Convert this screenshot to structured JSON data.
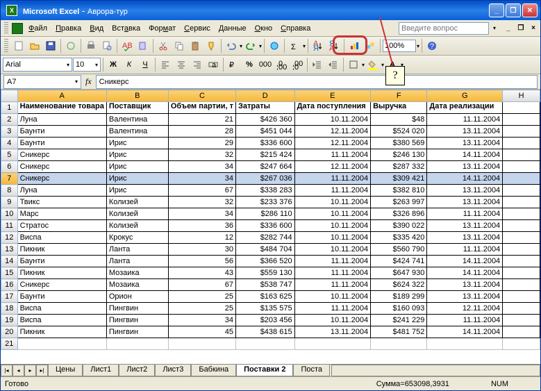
{
  "title_app": "Microsoft Excel",
  "title_doc": "Аврора-тур",
  "menus": {
    "file": "Файл",
    "edit": "Правка",
    "view": "Вид",
    "insert": "Вставка",
    "format": "Формат",
    "service": "Сервис",
    "data": "Данные",
    "window": "Окно",
    "help": "Справка"
  },
  "question_placeholder": "Введите вопрос",
  "zoom": "100%",
  "font_name": "Arial",
  "font_size": "10",
  "namebox": "A7",
  "formula": "Сникерс",
  "callout_text": "?",
  "columns": [
    "A",
    "B",
    "C",
    "D",
    "E",
    "F",
    "G",
    "H"
  ],
  "headers": {
    "col1": "Наименование товара",
    "col2": "Поставщик",
    "col3": "Объем партии, т",
    "col4": "Затраты",
    "col5": "Дата поступления",
    "col6": "Выручка",
    "col7": "Дата реализации"
  },
  "rows": [
    {
      "n": 2,
      "a": "Луна",
      "b": "Валентина",
      "c": "21",
      "d": "$426 360",
      "e": "10.11.2004",
      "f": "$48",
      "g": "11.11.2004"
    },
    {
      "n": 3,
      "a": "Баунти",
      "b": "Валентина",
      "c": "28",
      "d": "$451 044",
      "e": "12.11.2004",
      "f": "$524 020",
      "g": "13.11.2004"
    },
    {
      "n": 4,
      "a": "Баунти",
      "b": "Ирис",
      "c": "29",
      "d": "$336 600",
      "e": "12.11.2004",
      "f": "$380 569",
      "g": "13.11.2004"
    },
    {
      "n": 5,
      "a": "Сникерс",
      "b": "Ирис",
      "c": "32",
      "d": "$215 424",
      "e": "11.11.2004",
      "f": "$246 130",
      "g": "14.11.2004"
    },
    {
      "n": 6,
      "a": "Сникерс",
      "b": "Ирис",
      "c": "34",
      "d": "$247 664",
      "e": "12.11.2004",
      "f": "$287 332",
      "g": "13.11.2004"
    },
    {
      "n": 7,
      "a": "Сникерс",
      "b": "Ирис",
      "c": "34",
      "d": "$267 036",
      "e": "11.11.2004",
      "f": "$309 421",
      "g": "14.11.2004",
      "sel": true
    },
    {
      "n": 8,
      "a": "Луна",
      "b": "Ирис",
      "c": "67",
      "d": "$338 283",
      "e": "11.11.2004",
      "f": "$382 810",
      "g": "13.11.2004"
    },
    {
      "n": 9,
      "a": "Твикс",
      "b": "Колизей",
      "c": "32",
      "d": "$233 376",
      "e": "10.11.2004",
      "f": "$263 997",
      "g": "13.11.2004"
    },
    {
      "n": 10,
      "a": "Марс",
      "b": "Колизей",
      "c": "34",
      "d": "$286 110",
      "e": "10.11.2004",
      "f": "$326 896",
      "g": "11.11.2004"
    },
    {
      "n": 11,
      "a": "Стратос",
      "b": "Колизей",
      "c": "36",
      "d": "$336 600",
      "e": "10.11.2004",
      "f": "$390 022",
      "g": "13.11.2004"
    },
    {
      "n": 12,
      "a": "Виспа",
      "b": "Крокус",
      "c": "12",
      "d": "$282 744",
      "e": "10.11.2004",
      "f": "$335 420",
      "g": "13.11.2004"
    },
    {
      "n": 13,
      "a": "Пикник",
      "b": "Ланта",
      "c": "30",
      "d": "$484 704",
      "e": "10.11.2004",
      "f": "$560 790",
      "g": "11.11.2004"
    },
    {
      "n": 14,
      "a": "Баунти",
      "b": "Ланта",
      "c": "56",
      "d": "$366 520",
      "e": "11.11.2004",
      "f": "$424 741",
      "g": "14.11.2004"
    },
    {
      "n": 15,
      "a": "Пикник",
      "b": "Мозаика",
      "c": "43",
      "d": "$559 130",
      "e": "11.11.2004",
      "f": "$647 930",
      "g": "14.11.2004"
    },
    {
      "n": 16,
      "a": "Сникерс",
      "b": "Мозаика",
      "c": "67",
      "d": "$538 747",
      "e": "11.11.2004",
      "f": "$624 322",
      "g": "13.11.2004"
    },
    {
      "n": 17,
      "a": "Баунти",
      "b": "Орион",
      "c": "25",
      "d": "$163 625",
      "e": "10.11.2004",
      "f": "$189 299",
      "g": "13.11.2004"
    },
    {
      "n": 18,
      "a": "Виспа",
      "b": "Пингвин",
      "c": "25",
      "d": "$135 575",
      "e": "11.11.2004",
      "f": "$160 093",
      "g": "12.11.2004"
    },
    {
      "n": 19,
      "a": "Виспа",
      "b": "Пингвин",
      "c": "34",
      "d": "$203 456",
      "e": "10.11.2004",
      "f": "$241 229",
      "g": "11.11.2004"
    },
    {
      "n": 20,
      "a": "Пикник",
      "b": "Пингвин",
      "c": "45",
      "d": "$438 615",
      "e": "13.11.2004",
      "f": "$481 752",
      "g": "14.11.2004"
    }
  ],
  "sheet_tabs": [
    "Цены",
    "Лист1",
    "Лист2",
    "Лист3",
    "Бабкина",
    "Поставки 2",
    "Поста"
  ],
  "active_tab": 5,
  "status_ready": "Готово",
  "status_sum": "Сумма=653098,3931",
  "status_num": "NUM"
}
